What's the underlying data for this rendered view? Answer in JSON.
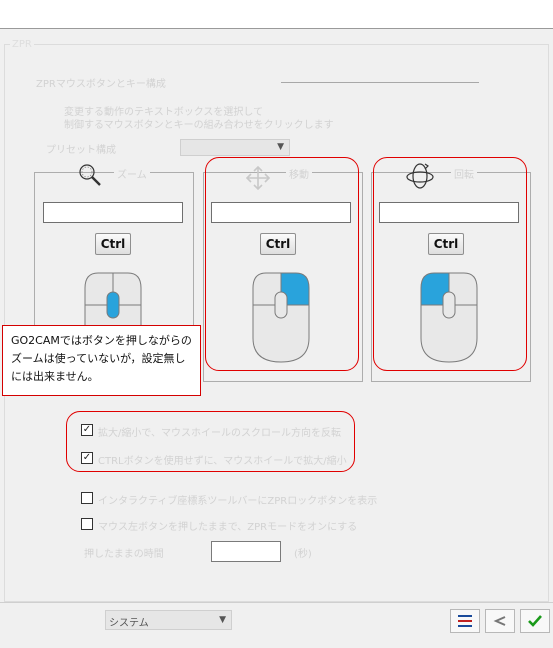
{
  "group_title": "ZPR",
  "heading": "ZPRマウスボタンとキー構成",
  "instruction_line1": "変更する動作のテキストボックスを選択して",
  "instruction_line2": "制御するマウスボタンとキーの組み合わせをクリックします",
  "preset": {
    "label": "プリセット構成",
    "value": ""
  },
  "panels": [
    {
      "label": "ズーム",
      "icon": "magnifier-icon",
      "field_value": "",
      "key_label": "Ctrl",
      "highlight": "middle"
    },
    {
      "label": "移動",
      "icon": "move-arrows-icon",
      "field_value": "",
      "key_label": "Ctrl",
      "highlight": "right"
    },
    {
      "label": "回転",
      "icon": "rotate-orbit-icon",
      "field_value": "",
      "key_label": "Ctrl",
      "highlight": "left"
    }
  ],
  "callout_text": "GO2CAMではボタンを押しながらのズームは使っていないが，設定無しには出来ません。",
  "options": [
    {
      "label": "拡大/縮小で、マウスホイールのスクロール方向を反転",
      "checked": true
    },
    {
      "label": "CTRLボタンを使用せずに、マウスホイールで拡大/縮小",
      "checked": true
    },
    {
      "label": "インタラクティブ座標系ツールバーにZPRロックボタンを表示",
      "checked": false
    },
    {
      "label": "マウス左ボタンを押したままで、ZPRモードをオンにする",
      "checked": false
    }
  ],
  "hold_time": {
    "label": "押したままの時間",
    "value": "",
    "unit": "(秒)"
  },
  "footer": {
    "system_select": "システム"
  },
  "colors": {
    "accent_blue": "#29a3dc",
    "red_highlight": "#e00000",
    "ok_green": "#1a9a1a"
  }
}
